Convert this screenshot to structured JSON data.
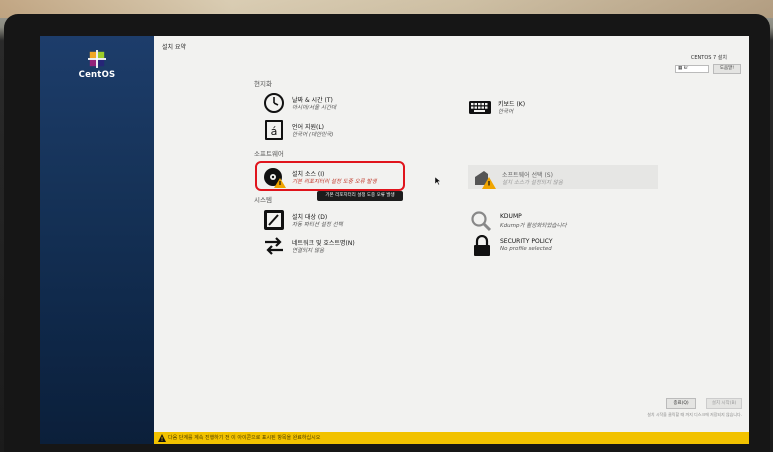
{
  "sidebar": {
    "logo_text": "CentOS"
  },
  "header": {
    "hub_title": "설치 요약",
    "product_title": "CENTOS 7 설치",
    "keyboard_layout": "kr",
    "help_label": "도움말!"
  },
  "sections": {
    "localization": "현지화",
    "software": "소프트웨어",
    "system": "시스템"
  },
  "spokes": {
    "datetime": {
      "title": "날짜 & 시간 (T)",
      "status": "아시아/서울 시간대"
    },
    "keyboard": {
      "title": "키보드 (K)",
      "status": "한국어"
    },
    "language": {
      "title": "언어 지원(L)",
      "status": "한국어 (대한민국)"
    },
    "source": {
      "title": "설치 소스 (I)",
      "status": "기본 리포지터리 설정 도중 오류 발생"
    },
    "software": {
      "title": "소프트웨어 선택 (S)",
      "status": "설치 소스가 설정되지 않음"
    },
    "destination": {
      "title": "설치 대상 (D)",
      "status": "자동 파티션 설정 선택"
    },
    "kdump": {
      "title": "KDUMP",
      "status": "Kdump가 활성화되었습니다"
    },
    "network": {
      "title": "네트워크 및 호스트명(N)",
      "status": "연결되지 않음"
    },
    "security": {
      "title": "SECURITY POLICY",
      "status": "No profile selected"
    }
  },
  "tooltip": "기본 리포지터리 설정 도중 오류 발생",
  "footer": {
    "quit_label": "종료(Q)",
    "begin_label": "설치 시작(B)",
    "note": "설치 시작을 클릭할 때 까지 디스크에 저장되지 않습니다.",
    "warning": "다음 단계를 계속 진행하기 전 이 아이콘으로 표시된 항목을 완료하십시오"
  },
  "colors": {
    "sidebar": "#163359",
    "warning_bar": "#f2c200",
    "highlight": "#e0141c",
    "warning_text": "#c0392b"
  }
}
